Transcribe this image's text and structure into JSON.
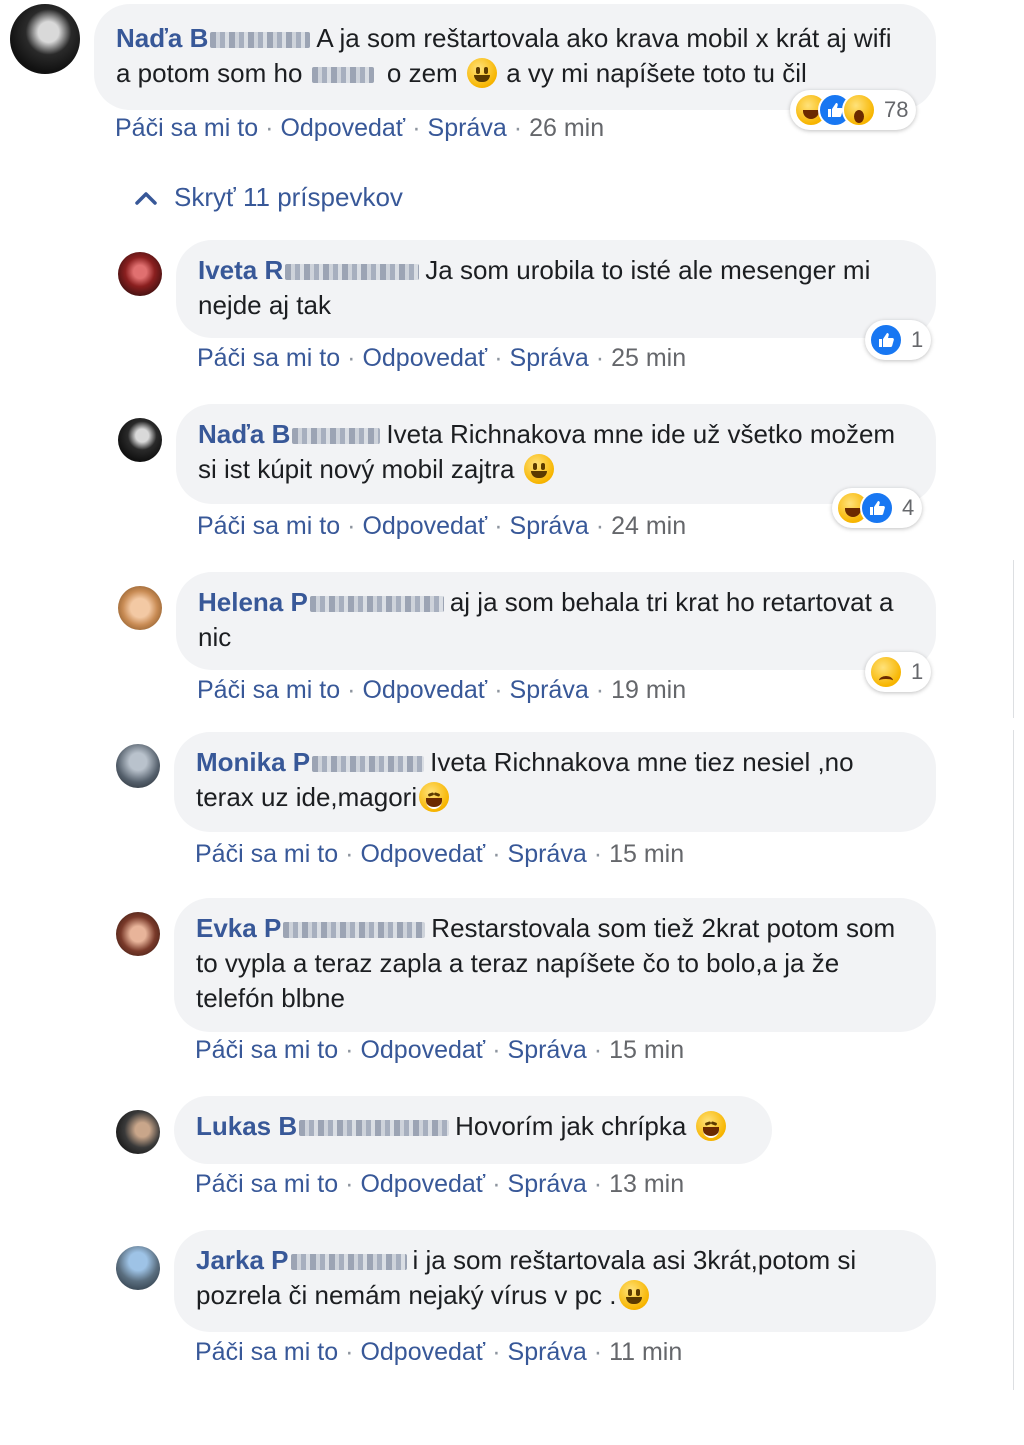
{
  "toggle": {
    "label": "Skryť 11 príspevkov",
    "icon": "chevron-up-icon"
  },
  "action_labels": {
    "like": "Páči sa mi to",
    "reply": "Odpovedať",
    "message": "Správa"
  },
  "colors": {
    "link": "#385898",
    "bubble": "#f2f3f5",
    "muted": "#65676b",
    "like_blue": "#1877f2",
    "emoji_yellow": "#f7b500"
  },
  "comments": [
    {
      "author": "Naďa B",
      "text_a": "A ja som reštartovala ako krava mobil x krát aj wifi a potom som ho",
      "text_b": "o zem",
      "text_c": "a vy mi napíšete toto tu čil",
      "time": "26 min",
      "reactions": [
        "haha",
        "like",
        "wow"
      ],
      "reaction_count": "78"
    },
    {
      "author": "Iveta R",
      "text": "Ja som urobila to isté ale mesenger mi nejde aj tak",
      "time": "25 min",
      "reactions": [
        "like"
      ],
      "reaction_count": "1"
    },
    {
      "author": "Naďa B",
      "text": "Iveta Richnakova mne ide už všetko možem si ist kúpit nový mobil zajtra",
      "time": "24 min",
      "reactions": [
        "haha",
        "like"
      ],
      "reaction_count": "4"
    },
    {
      "author": "Helena P",
      "text": "aj ja som behala tri krat ho retartovat a nic",
      "time": "19 min",
      "reactions": [
        "sad"
      ],
      "reaction_count": "1"
    },
    {
      "author": "Monika P",
      "text": "Iveta Richnakova mne tiez nesiel ,no terax uz ide,magori",
      "time": "15 min"
    },
    {
      "author": "Evka P",
      "text": "Restarstovala som tiež 2krat potom som to vypla a teraz zapla a teraz napíšete čo to bolo,a ja že telefón blbne",
      "time": "15 min"
    },
    {
      "author": "Lukas B",
      "text": "Hovorím jak chrípka",
      "time": "13 min"
    },
    {
      "author": "Jarka P",
      "text": "i ja som reštartovala asi 3krát,potom si pozrela či nemám nejaký vírus v pc .",
      "time": "11 min"
    }
  ]
}
